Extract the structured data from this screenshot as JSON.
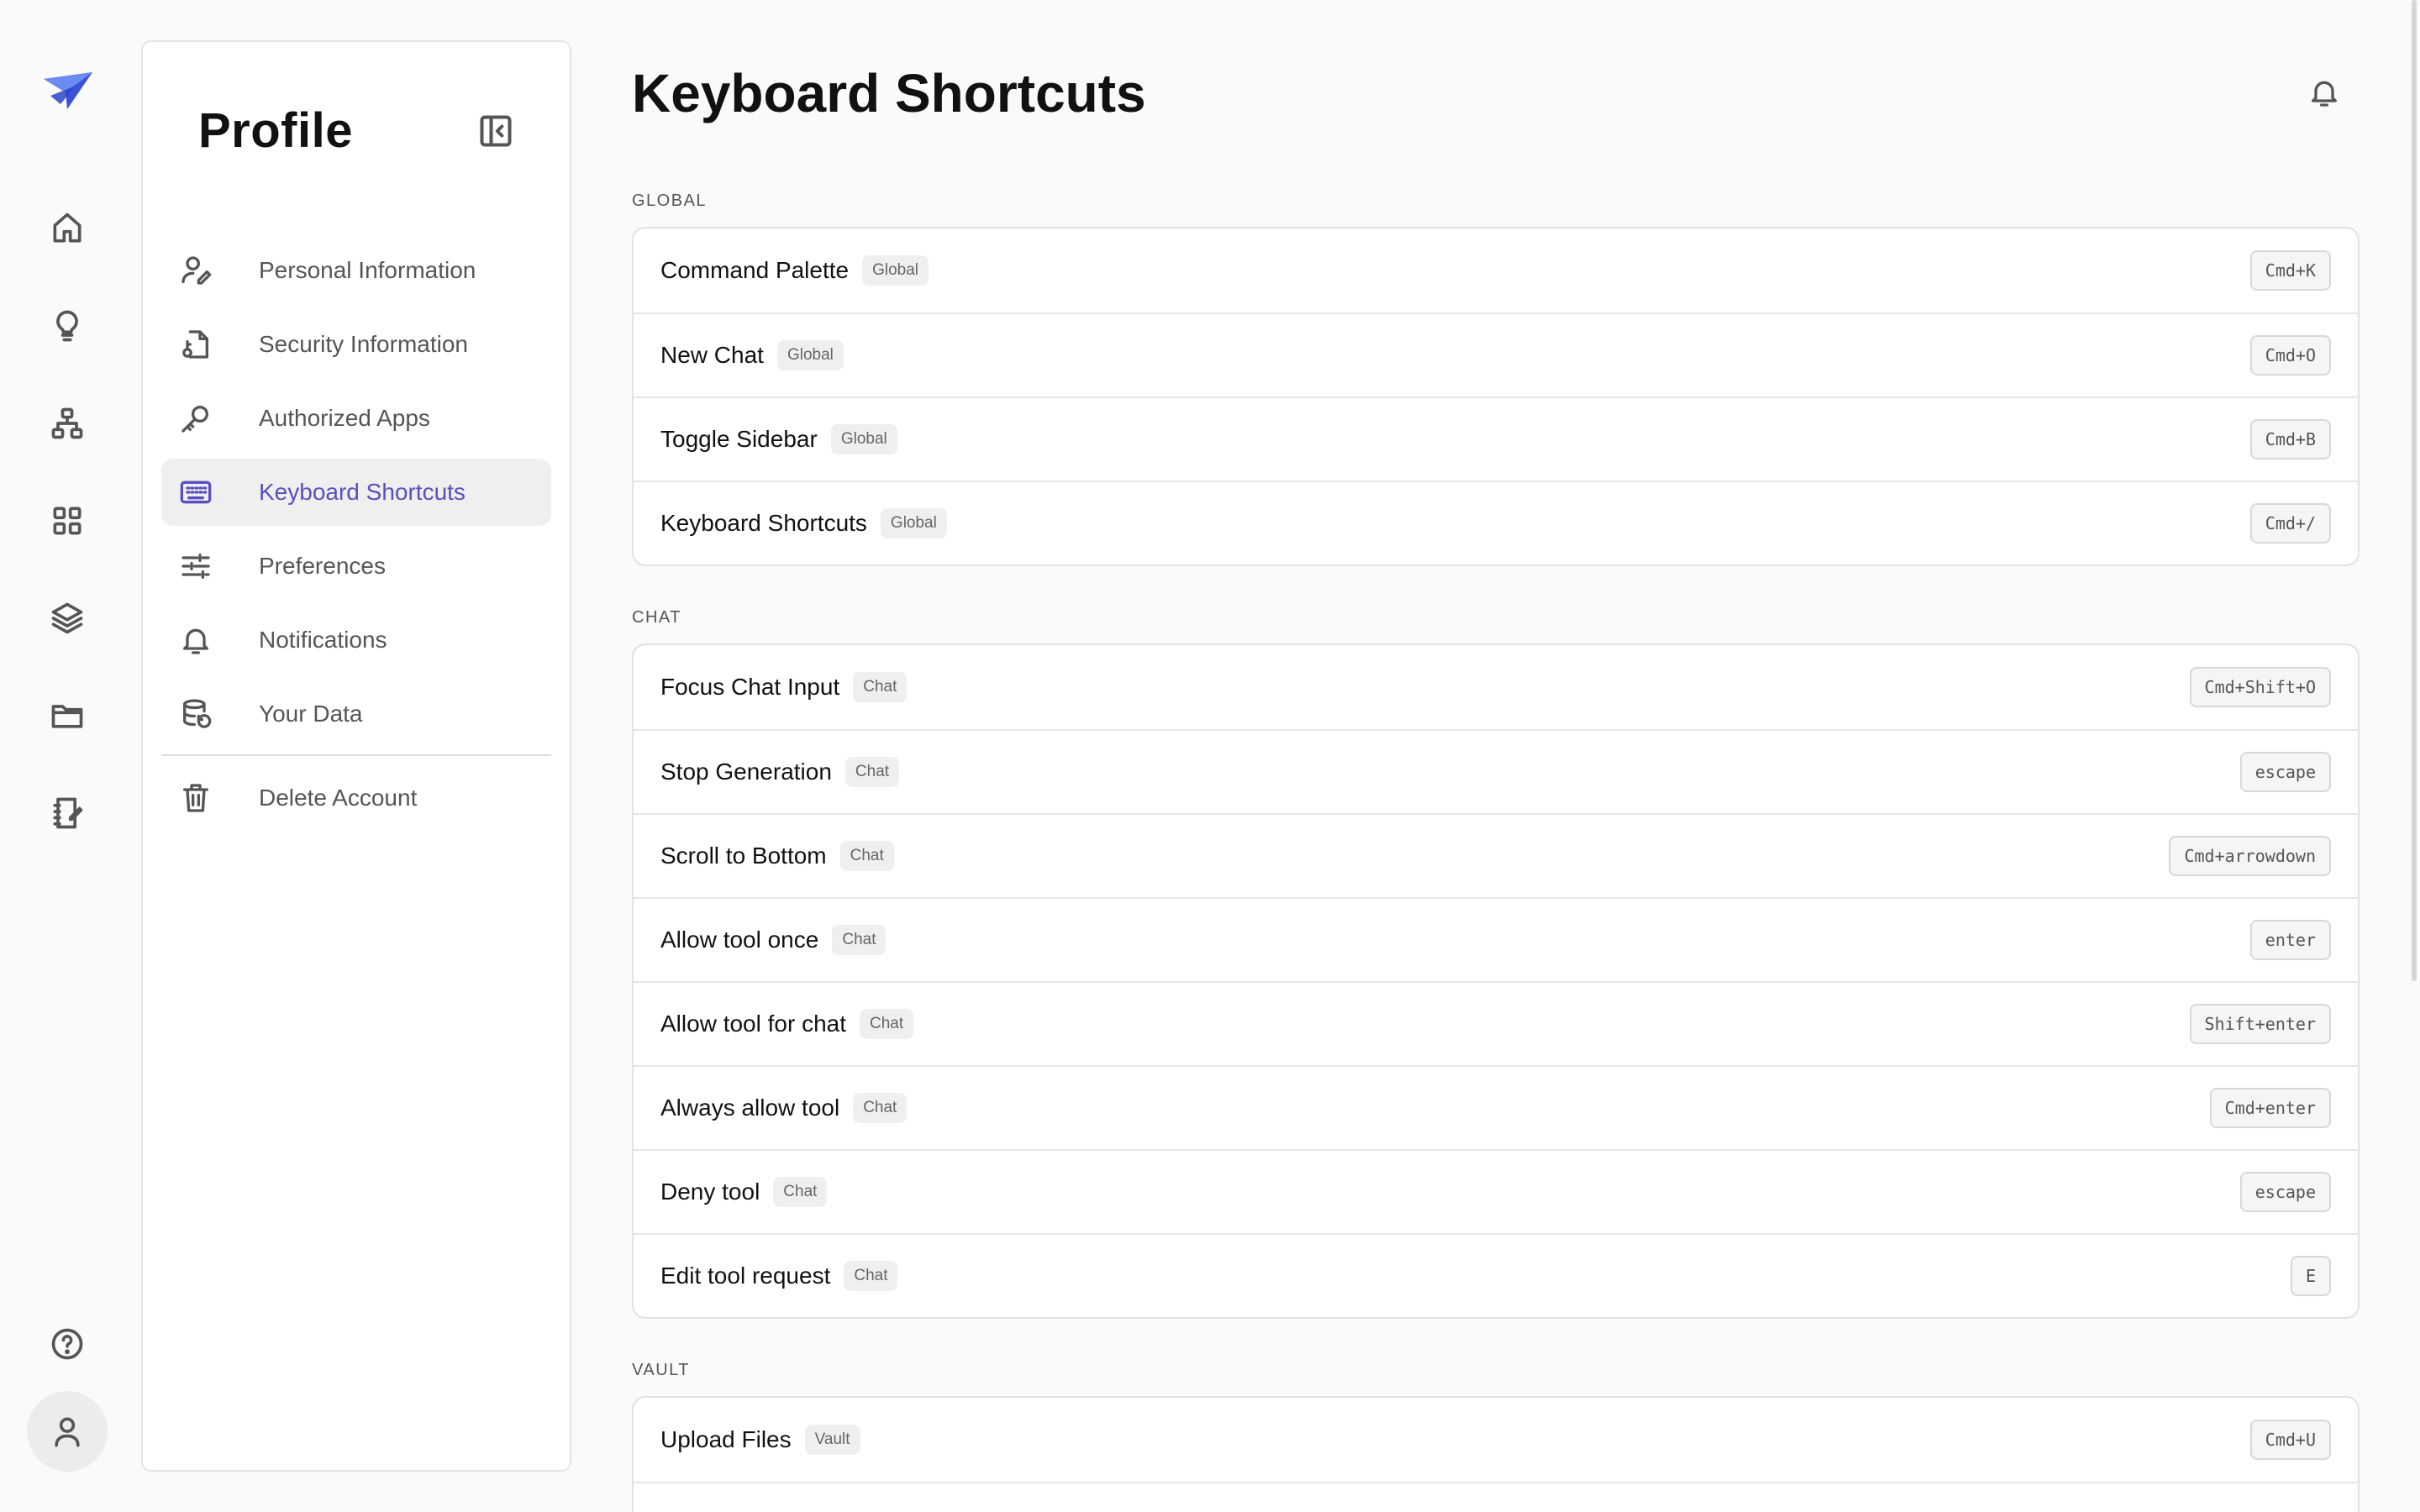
{
  "colors": {
    "accent": "#5a4fbf",
    "logo_primary": "#3b52d8",
    "logo_secondary": "#6a8cf0",
    "background": "#fafafa"
  },
  "rail": {
    "icons": [
      "logo-icon",
      "home-icon",
      "lightbulb-icon",
      "sitemap-icon",
      "grid-icon",
      "layers-icon",
      "folder-icon",
      "notebook-icon",
      "help-icon",
      "user-icon"
    ]
  },
  "panel": {
    "title": "Profile",
    "items": [
      {
        "label": "Personal Information",
        "icon": "user-edit-icon"
      },
      {
        "label": "Security Information",
        "icon": "file-key-icon"
      },
      {
        "label": "Authorized Apps",
        "icon": "key-icon"
      },
      {
        "label": "Keyboard Shortcuts",
        "icon": "keyboard-icon",
        "active": true
      },
      {
        "label": "Preferences",
        "icon": "sliders-icon"
      },
      {
        "label": "Notifications",
        "icon": "bell-icon"
      },
      {
        "label": "Your Data",
        "icon": "database-icon"
      }
    ],
    "danger_item": {
      "label": "Delete Account",
      "icon": "trash-icon"
    }
  },
  "main": {
    "title": "Keyboard Shortcuts",
    "sections": [
      {
        "label": "GLOBAL",
        "rows": [
          {
            "label": "Command Palette",
            "tag": "Global",
            "key": "Cmd+K"
          },
          {
            "label": "New Chat",
            "tag": "Global",
            "key": "Cmd+O"
          },
          {
            "label": "Toggle Sidebar",
            "tag": "Global",
            "key": "Cmd+B"
          },
          {
            "label": "Keyboard Shortcuts",
            "tag": "Global",
            "key": "Cmd+/"
          }
        ]
      },
      {
        "label": "CHAT",
        "rows": [
          {
            "label": "Focus Chat Input",
            "tag": "Chat",
            "key": "Cmd+Shift+O"
          },
          {
            "label": "Stop Generation",
            "tag": "Chat",
            "key": "escape"
          },
          {
            "label": "Scroll to Bottom",
            "tag": "Chat",
            "key": "Cmd+arrowdown"
          },
          {
            "label": "Allow tool once",
            "tag": "Chat",
            "key": "enter"
          },
          {
            "label": "Allow tool for chat",
            "tag": "Chat",
            "key": "Shift+enter"
          },
          {
            "label": "Always allow tool",
            "tag": "Chat",
            "key": "Cmd+enter"
          },
          {
            "label": "Deny tool",
            "tag": "Chat",
            "key": "escape"
          },
          {
            "label": "Edit tool request",
            "tag": "Chat",
            "key": "E"
          }
        ]
      },
      {
        "label": "VAULT",
        "rows": [
          {
            "label": "Upload Files",
            "tag": "Vault",
            "key": "Cmd+U"
          }
        ]
      }
    ]
  }
}
